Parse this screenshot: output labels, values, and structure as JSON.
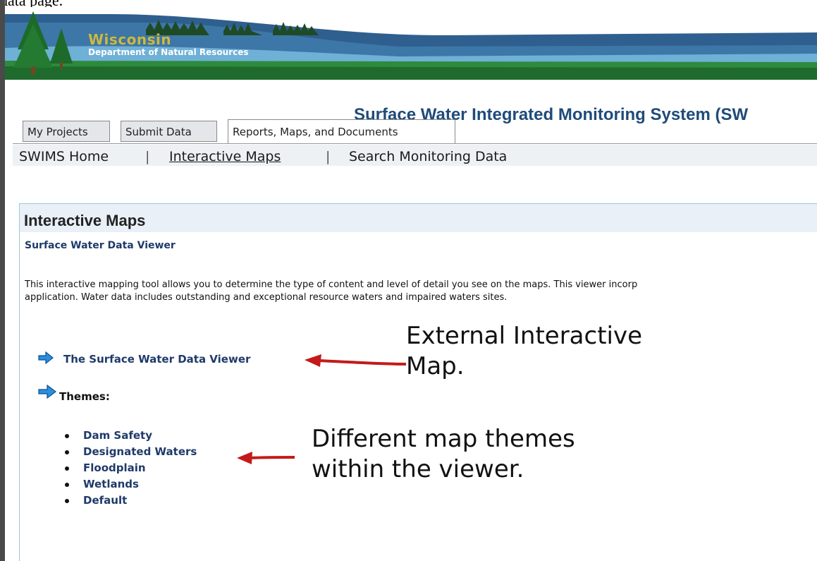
{
  "top_fragment": "data page.",
  "header": {
    "logo_title": "Wisconsin",
    "logo_subtitle": "Department of Natural Resources",
    "system_title": "Surface Water Integrated Monitoring System (SW"
  },
  "tabs": [
    {
      "label": "My Projects"
    },
    {
      "label": "Submit Data"
    },
    {
      "label": "Reports, Maps, and Documents",
      "active": true
    }
  ],
  "subnav": {
    "home": "SWIMS Home",
    "separator": "|",
    "maps": "Interactive Maps",
    "search": "Search Monitoring Data"
  },
  "panel": {
    "title": "Interactive Maps",
    "subheading": "Surface Water Data Viewer",
    "description_line1": "This interactive mapping tool allows you to determine the type of content and level of detail you see on the maps. This viewer incorp",
    "description_line2": "application. Water data includes outstanding and exceptional resource waters and impaired waters sites.",
    "viewer_link": "The Surface Water Data Viewer",
    "themes_label": "Themes:",
    "themes": [
      "Dam Safety",
      "Designated Waters",
      "Floodplain",
      "Wetlands",
      "Default"
    ]
  },
  "annotations": {
    "external_line1": "External Interactive",
    "external_line2": "Map.",
    "themes_line1": "Different map themes",
    "themes_line2": "within the viewer."
  },
  "colors": {
    "link_blue": "#1f3a6a",
    "title_blue": "#1f4b7a",
    "arrow_blue": "#2a8fe0",
    "annotation_red": "#c41a1a"
  },
  "icons": {
    "link_arrow": "right-arrow-icon",
    "annotation_arrow": "left-arrow-icon"
  }
}
